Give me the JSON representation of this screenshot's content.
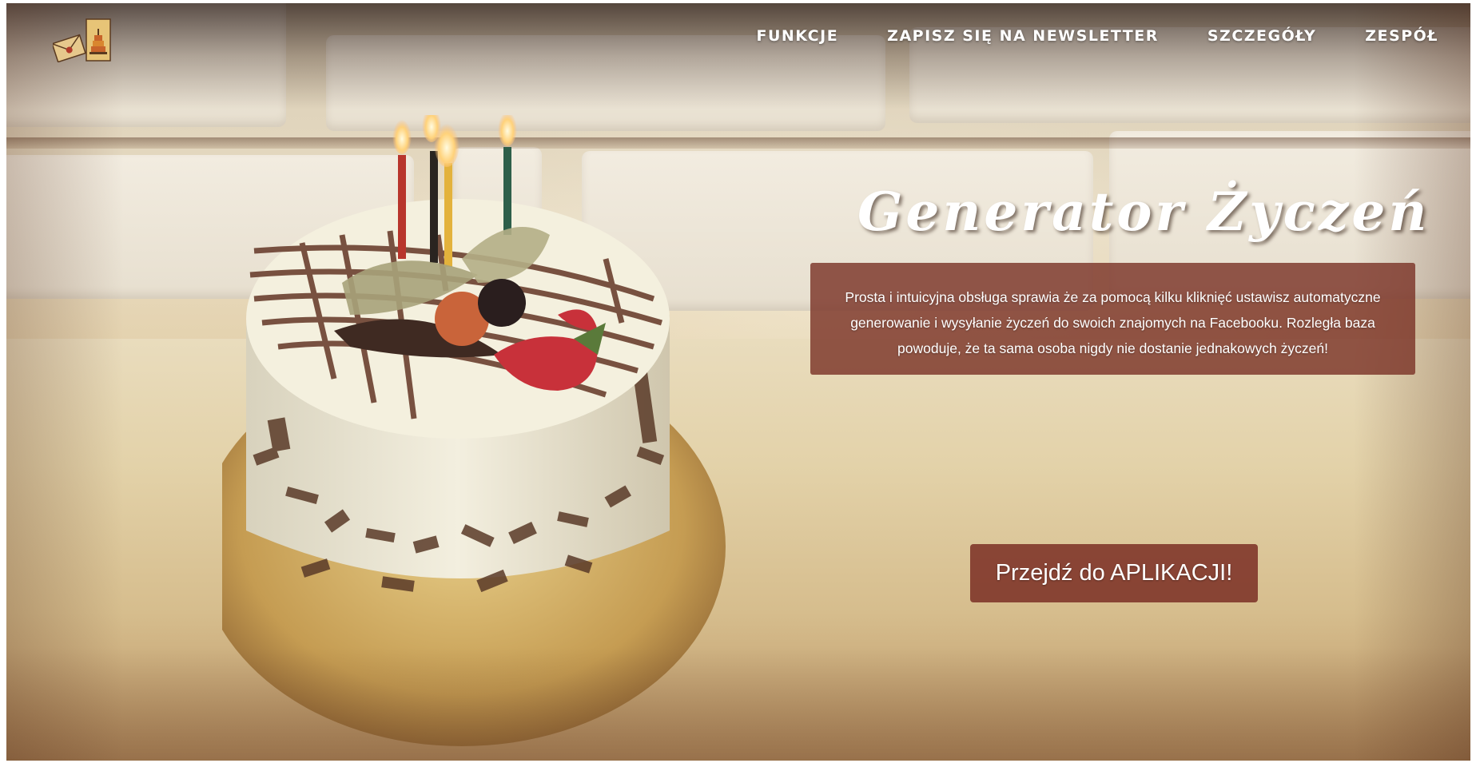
{
  "header": {
    "logo_icon": "envelope-and-cake-icon",
    "nav": [
      {
        "label": "FUNKCJE"
      },
      {
        "label": "ZAPISZ SIĘ NA NEWSLETTER"
      },
      {
        "label": "SZCZEGÓŁY"
      },
      {
        "label": "ZESPÓŁ"
      }
    ]
  },
  "hero": {
    "title": "Generator Życzeń",
    "description": "Prosta i intuicyjna obsługa sprawia że za pomocą kilku kliknięć ustawisz automatyczne generowanie i wysyłanie życzeń do swoich znajomych na Facebooku. Rozległa baza powoduje, że ta sama osoba nigdy nie dostanie jednakowych życzeń!",
    "cta_label": "Przejdź do APLIKACJI!"
  },
  "colors": {
    "accent": "#7b3428",
    "text_light": "#ffffff"
  }
}
